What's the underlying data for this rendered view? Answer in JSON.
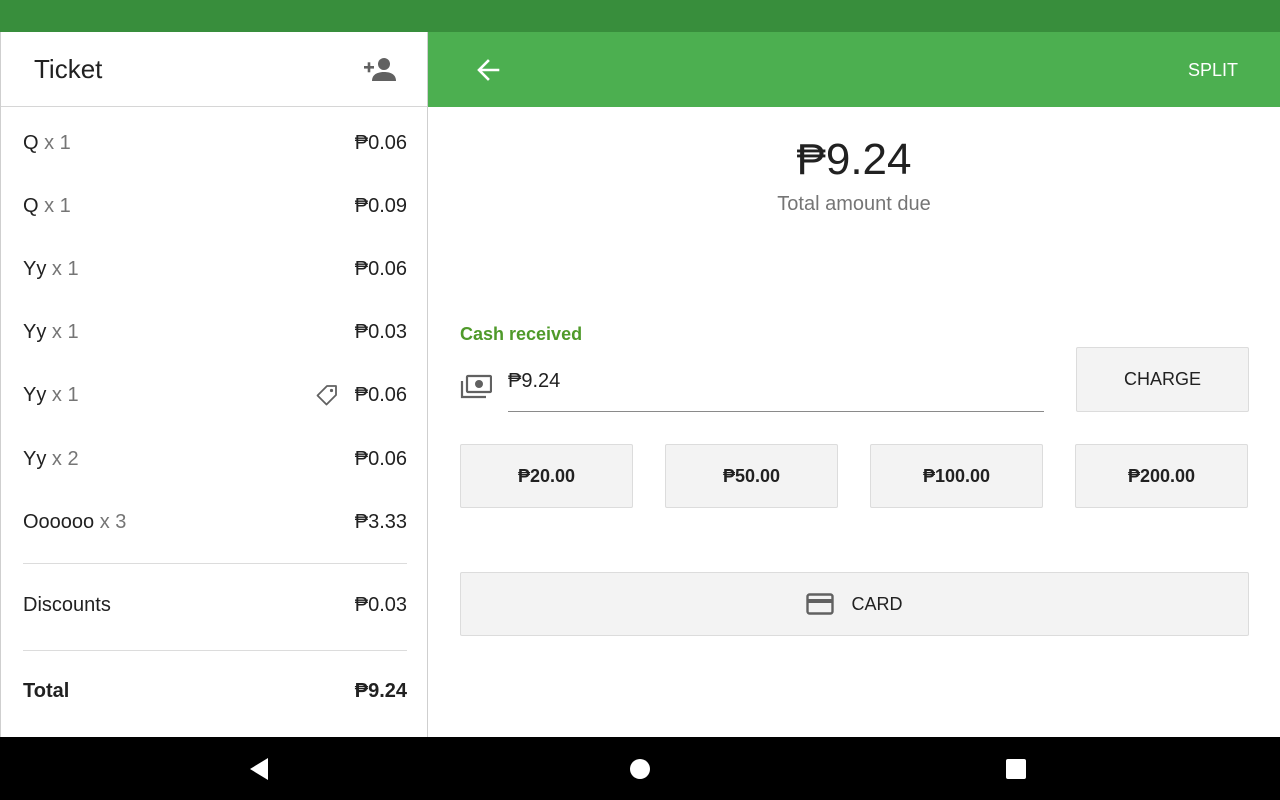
{
  "ticket": {
    "title": "Ticket",
    "items": [
      {
        "name": "Q",
        "qty": "x 1",
        "price": "₱0.06",
        "discount_tag": false
      },
      {
        "name": "Q",
        "qty": "x 1",
        "price": "₱0.09",
        "discount_tag": false
      },
      {
        "name": "Yy",
        "qty": "x 1",
        "price": "₱0.06",
        "discount_tag": false
      },
      {
        "name": "Yy",
        "qty": "x 1",
        "price": "₱0.03",
        "discount_tag": false
      },
      {
        "name": "Yy",
        "qty": "x 1",
        "price": "₱0.06",
        "discount_tag": true
      },
      {
        "name": "Yy",
        "qty": "x 2",
        "price": "₱0.06",
        "discount_tag": false
      },
      {
        "name": "Oooooo",
        "qty": "x 3",
        "price": "₱3.33",
        "discount_tag": false
      }
    ],
    "discounts_label": "Discounts",
    "discounts_value": "₱0.03",
    "total_label": "Total",
    "total_value": "₱9.24"
  },
  "header": {
    "split_label": "SPLIT"
  },
  "payment": {
    "amount": "₱9.24",
    "amount_label": "Total amount due",
    "cash_label": "Cash received",
    "cash_value": "₱9.24",
    "charge_label": "CHARGE",
    "quick_amounts": [
      "₱20.00",
      "₱50.00",
      "₱100.00",
      "₱200.00"
    ],
    "card_label": "CARD"
  },
  "icons": {
    "add_customer": "person-add-icon",
    "back": "arrow-back-icon",
    "discount": "tag-icon",
    "cash": "cash-icon",
    "card": "credit-card-icon"
  },
  "colors": {
    "status_bar": "#388e3c",
    "app_bar": "#4caf50",
    "cash_label": "#4f9a2a"
  }
}
